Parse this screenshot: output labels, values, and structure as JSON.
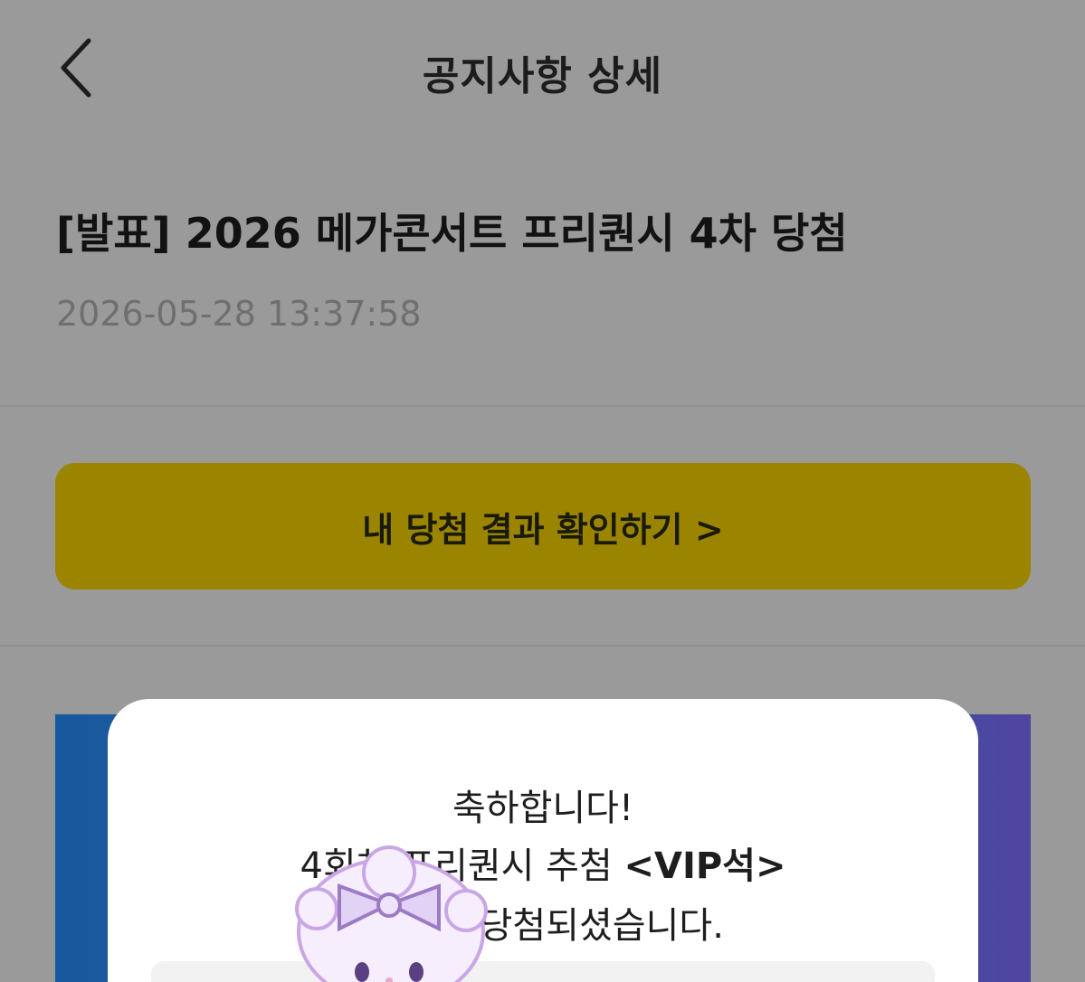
{
  "header": {
    "back_icon": "chevron-left-icon",
    "title": "공지사항 상세"
  },
  "notice": {
    "title": "[발표] 2026 메가콘서트 프리퀀시 4차 당첨",
    "date": "2026-05-28 13:37:58"
  },
  "result_button": {
    "label": "내 당첨 결과 확인하기 >"
  },
  "modal": {
    "line1": "축하합니다!",
    "line2_prefix": "4회차 프리퀀시 추첨 ",
    "line2_highlight": "<VIP석>",
    "line3": "에 당첨되셨습니다."
  },
  "sticker": {
    "icon": "character-sticker-icon"
  },
  "colors": {
    "background_overlay": "#9a9a9a",
    "button": "#9b8500",
    "banner_start": "#17599d",
    "banner_end": "#4f45a0",
    "modal": "#ffffff"
  }
}
